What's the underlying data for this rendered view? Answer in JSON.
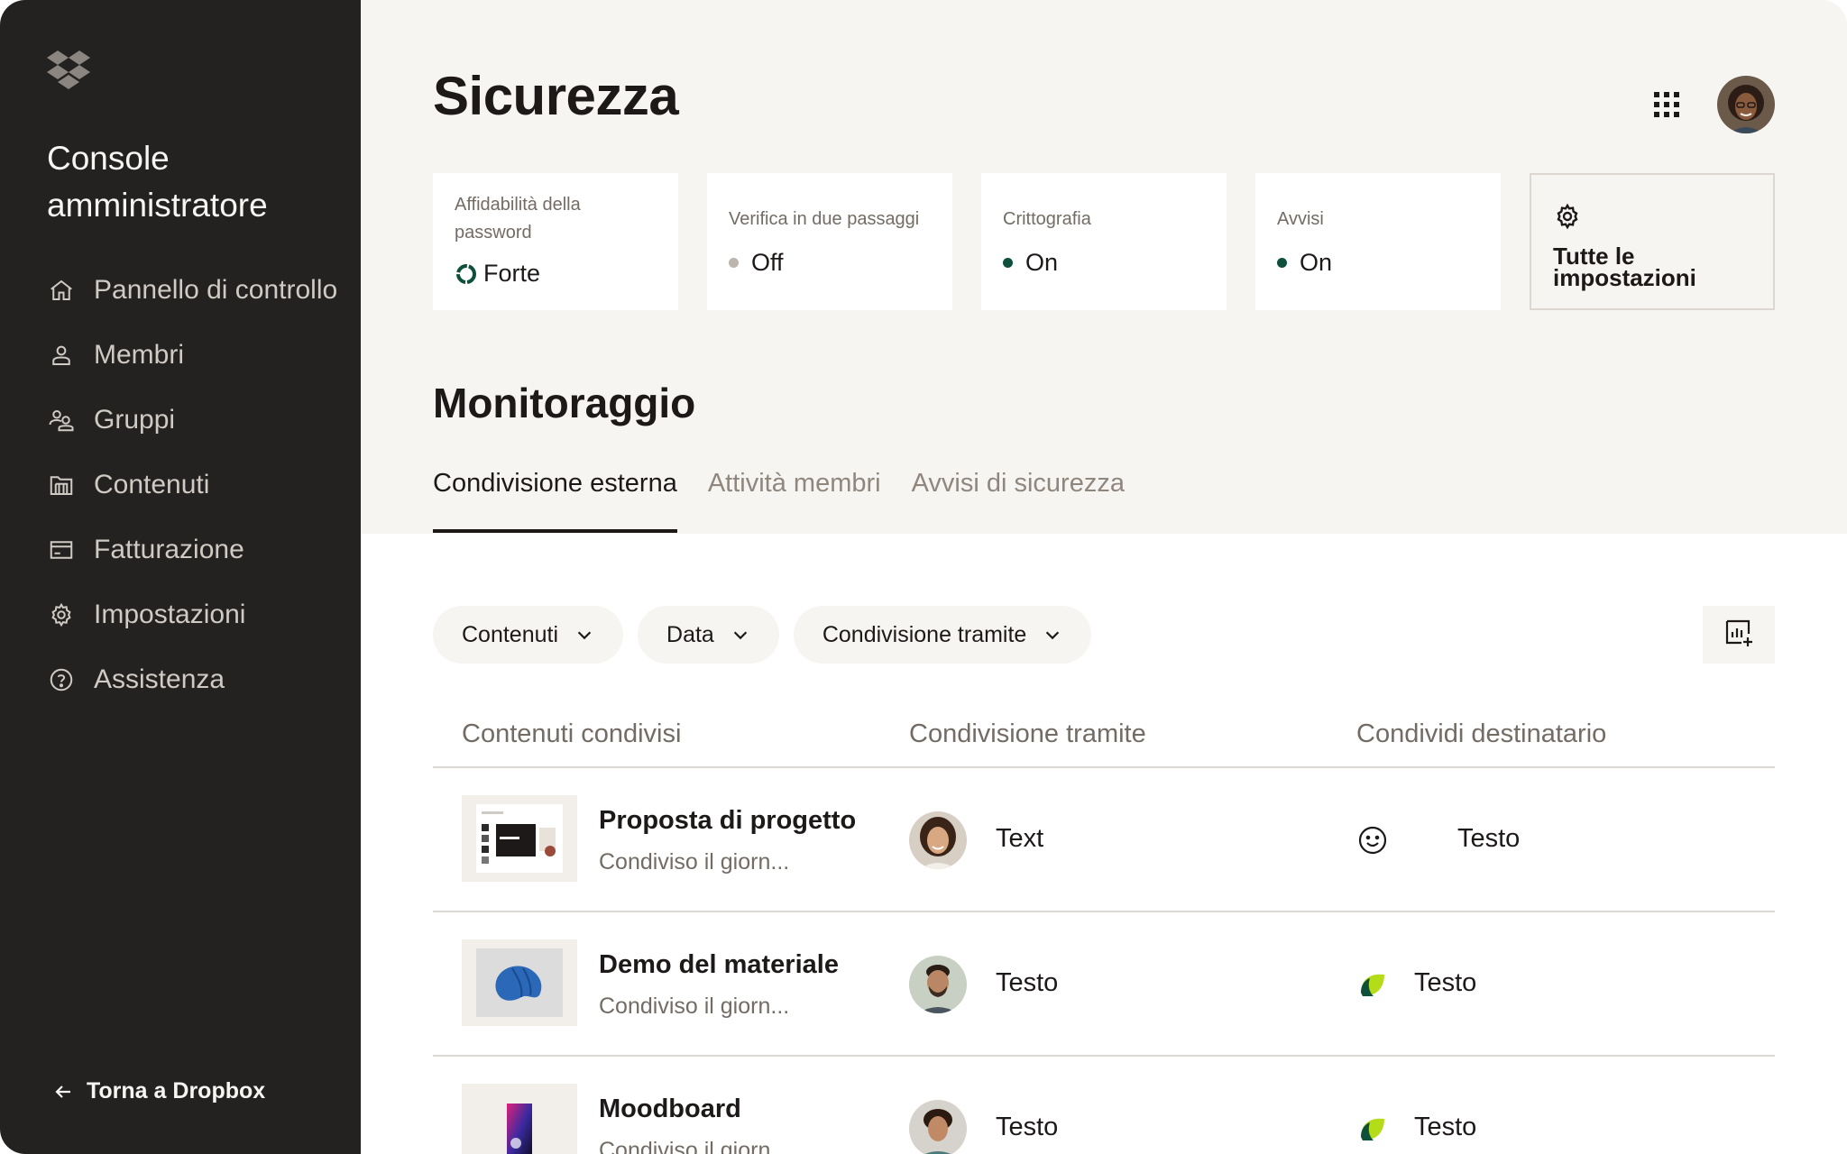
{
  "sidebar": {
    "title": "Console amministratore",
    "items": [
      {
        "label": "Pannello di controllo",
        "icon": "home-icon"
      },
      {
        "label": "Membri",
        "icon": "person-icon"
      },
      {
        "label": "Gruppi",
        "icon": "group-icon"
      },
      {
        "label": "Contenuti",
        "icon": "folder-icon"
      },
      {
        "label": "Fatturazione",
        "icon": "billing-icon"
      },
      {
        "label": "Impostazioni",
        "icon": "gear-icon"
      },
      {
        "label": "Assistenza",
        "icon": "help-icon"
      }
    ],
    "back_label": "Torna a Dropbox"
  },
  "header": {
    "title": "Sicurezza"
  },
  "cards": [
    {
      "label": "Affidabilità della password",
      "value": "Forte",
      "indicator": "strength-ring-icon"
    },
    {
      "label": "Verifica in due passaggi",
      "value": "Off",
      "dot_color": "#bbb5ae"
    },
    {
      "label": "Crittografia",
      "value": "On",
      "dot_color": "#0f503c"
    },
    {
      "label": "Avvisi",
      "value": "On",
      "dot_color": "#0f503c"
    }
  ],
  "settings_card": {
    "label": "Tutte le impostazioni"
  },
  "monitoring": {
    "title": "Monitoraggio",
    "tabs": [
      {
        "label": "Condivisione esterna",
        "active": true
      },
      {
        "label": "Attività membri",
        "active": false
      },
      {
        "label": "Avvisi di sicurezza",
        "active": false
      }
    ]
  },
  "filters": [
    {
      "label": "Contenuti"
    },
    {
      "label": "Data"
    },
    {
      "label": "Condivisione tramite"
    }
  ],
  "table": {
    "columns": [
      "Contenuti condivisi",
      "Condivisione tramite",
      "Condividi destinatario"
    ],
    "rows": [
      {
        "title": "Proposta di progetto",
        "subtitle": "Condiviso il giorn...",
        "shared_by": "Text",
        "recipient": "Testo",
        "recipient_icon": "smiley-icon"
      },
      {
        "title": "Demo del materiale",
        "subtitle": "Condiviso il giorn...",
        "shared_by": "Testo",
        "recipient": "Testo",
        "recipient_icon": "leaf-icon"
      },
      {
        "title": "Moodboard",
        "subtitle": "Condiviso il giorn...",
        "shared_by": "Testo",
        "recipient": "Testo",
        "recipient_icon": "leaf-icon"
      }
    ]
  },
  "colors": {
    "sidebar_bg": "#242121",
    "surface": "#f7f5f2",
    "text": "#1e1919",
    "muted": "#736c64",
    "accent_green": "#0f503c",
    "leaf_green": "#b4dc19"
  }
}
